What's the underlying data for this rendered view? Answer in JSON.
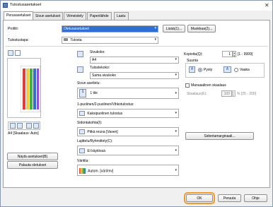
{
  "window": {
    "title": "Tulostusasetukset",
    "close_glyph": "✕"
  },
  "tabs": [
    {
      "label": "Perusasetukset",
      "active": true
    },
    {
      "label": "Sivun asetukset",
      "active": false
    },
    {
      "label": "Viimeistely",
      "active": false
    },
    {
      "label": "Paperilähde",
      "active": false
    },
    {
      "label": "Laatu",
      "active": false
    }
  ],
  "profile": {
    "label": "Profiili:",
    "value": "Oletusasetukset",
    "add_label": "Lisää(1)...",
    "edit_label": "Muokkaa(2)..."
  },
  "output_method": {
    "label": "Tulostustapa:",
    "value": "Tulosta"
  },
  "preview": {
    "status": "A4 [Skaalaus: Auto]"
  },
  "page_size": {
    "label": "Sivukoko:",
    "value": "A4"
  },
  "output_size": {
    "label": "Tulostekoko:",
    "value": "Sama sivukoko"
  },
  "page_layout": {
    "label": "Sivun asettelu:",
    "value": "1 1 tile",
    "number": "1",
    "text": "1 tile"
  },
  "duplex": {
    "label": "1-puolinen/2-puolinen/Vihkotulostus:",
    "value": "Kaksipuolinen tulostus"
  },
  "binding": {
    "label": "Sidontakohta(I):",
    "value": "Pitkä reuna [Vasen]"
  },
  "collate": {
    "label": "Lajittelu/Ryhmittely(C):",
    "value": "Ei käytössä"
  },
  "color": {
    "label": "Väritila:",
    "value": "Autom. [väri/mv]"
  },
  "copies": {
    "label": "Kopioita(Q):",
    "value": "1",
    "range": "[1 - 9999]"
  },
  "orientation": {
    "label": "Suunta",
    "portrait": "Pysty",
    "landscape": "Vaaka",
    "selected": "portrait",
    "portrait_glyph": "A",
    "landscape_glyph": "A"
  },
  "manual_scaling": {
    "label": "Manuaalinen skaalaus",
    "scaling_label": "Skaalaus(E):",
    "value": "100",
    "range": "% [25 - 200]"
  },
  "margins_button": "Sidontamarginaali...",
  "left_buttons": {
    "view_settings": "Näytä asetukset(B)",
    "restore_defaults": "Palauta oletukset"
  },
  "footer": {
    "ok": "OK",
    "cancel": "Peruuta",
    "help": "Ohje"
  },
  "colors": {
    "highlight": "#2f6fd1",
    "ok_ring": "#f29a2e"
  }
}
